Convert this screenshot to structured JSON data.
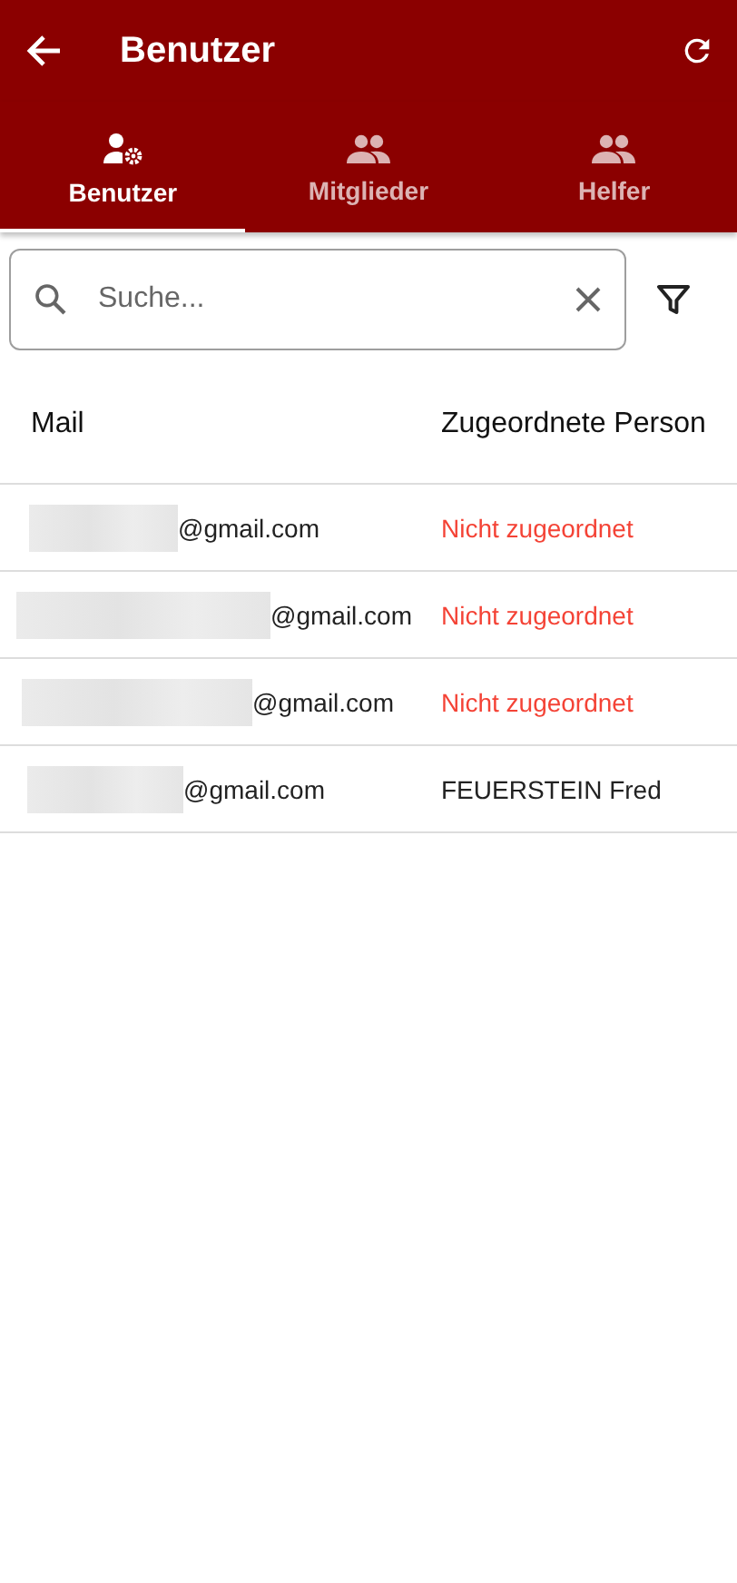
{
  "app_bar": {
    "title": "Benutzer"
  },
  "tabs": [
    {
      "label": "Benutzer",
      "kind": "user-settings",
      "selected": true
    },
    {
      "label": "Mitglieder",
      "kind": "group",
      "selected": false
    },
    {
      "label": "Helfer",
      "kind": "group",
      "selected": false
    }
  ],
  "search": {
    "placeholder": "Suche..."
  },
  "table": {
    "columns": [
      "Mail",
      "Zugeordnete Person"
    ],
    "rows": [
      {
        "mail": "@gmail.com",
        "person": "Nicht zugeordnet",
        "assigned": false
      },
      {
        "mail": "@gmail.com",
        "person": "Nicht zugeordnet",
        "assigned": false
      },
      {
        "mail": "@gmail.com",
        "person": "Nicht zugeordnet",
        "assigned": false
      },
      {
        "mail": "@gmail.com",
        "person": "FEUERSTEIN Fred",
        "assigned": true
      }
    ]
  }
}
